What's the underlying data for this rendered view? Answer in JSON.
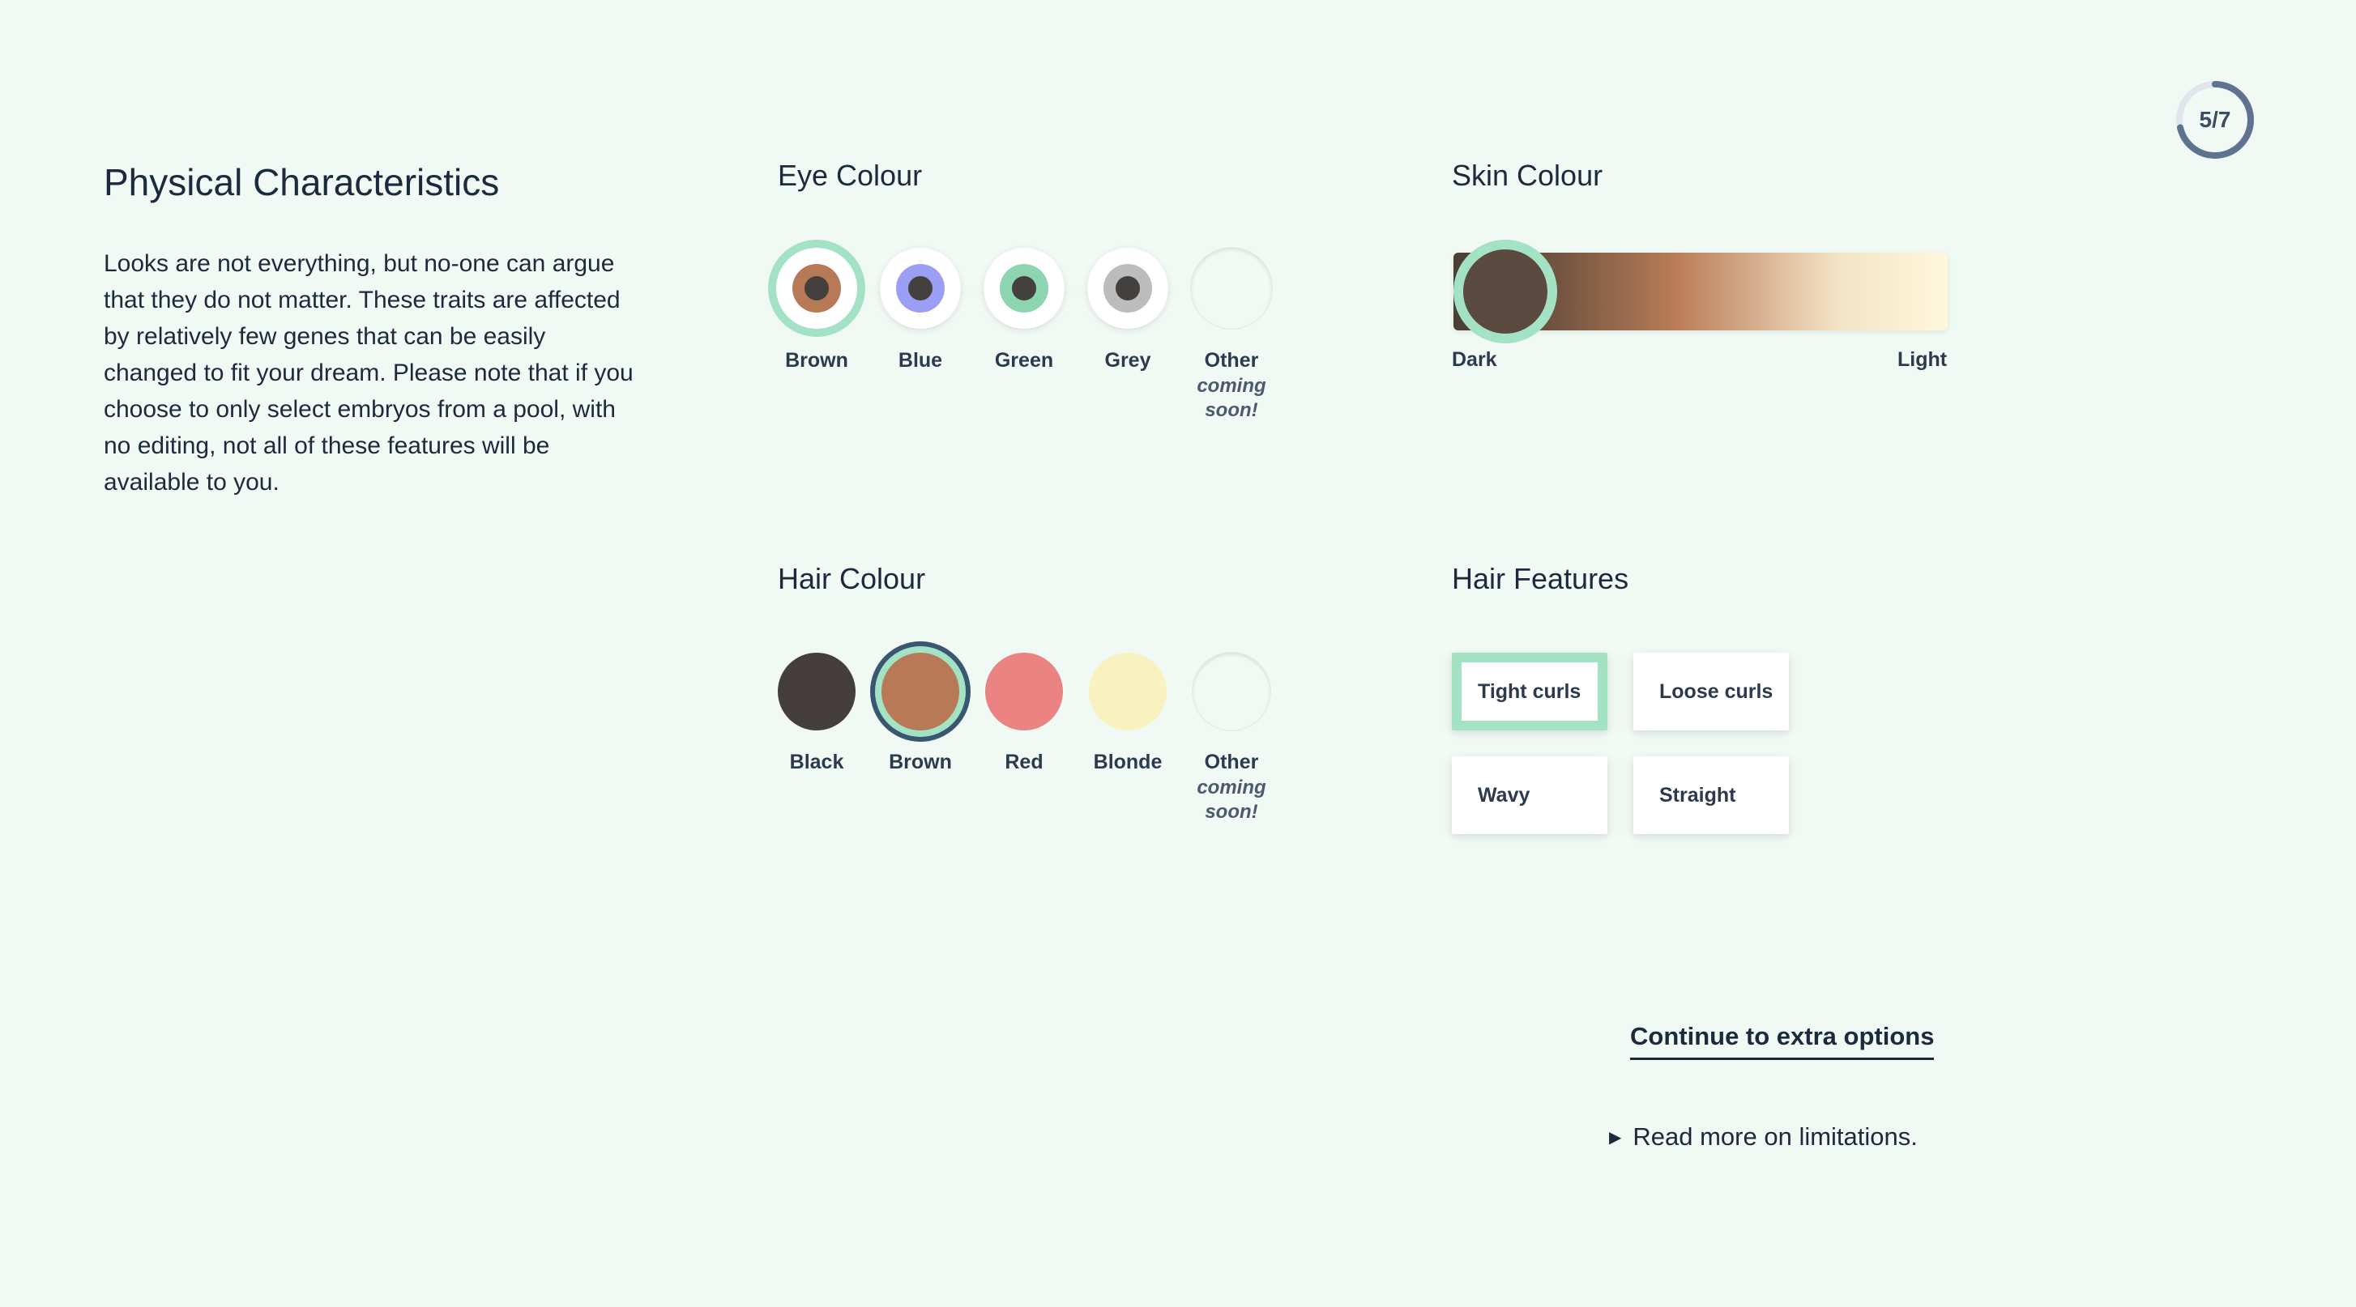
{
  "progress": {
    "label": "5/7",
    "value": 0.714,
    "ring_color": "#5f7391"
  },
  "intro": {
    "title": "Physical Characteristics",
    "text": "Looks are not everything, but no-one can argue that they do not matter. These traits are affected by relatively few genes that can be easily changed to fit your dream. Please note that if you choose to only select embryos from a pool, with no editing, not all of these features will be available to you."
  },
  "eye_colour": {
    "title": "Eye Colour",
    "selected": "Brown",
    "options": [
      {
        "label": "Brown",
        "iris": "#b87a56"
      },
      {
        "label": "Blue",
        "iris": "#9a9ef5"
      },
      {
        "label": "Green",
        "iris": "#8dd4b0"
      },
      {
        "label": "Grey",
        "iris": "#bcbcbc"
      },
      {
        "label": "Other",
        "note": "coming soon!"
      }
    ]
  },
  "skin_colour": {
    "title": "Skin Colour",
    "min_label": "Dark",
    "max_label": "Light",
    "value": 0.0,
    "gradient": [
      "#4c3f36",
      "#b97c57",
      "#f3e3c6",
      "#fff8dc"
    ]
  },
  "hair_colour": {
    "title": "Hair Colour",
    "selected": "Brown",
    "options": [
      {
        "label": "Black",
        "color": "#443f3d"
      },
      {
        "label": "Brown",
        "color": "#b87a56"
      },
      {
        "label": "Red",
        "color": "#ea8381"
      },
      {
        "label": "Blonde",
        "color": "#f8f1c0"
      },
      {
        "label": "Other",
        "note": "coming soon!"
      }
    ]
  },
  "hair_features": {
    "title": "Hair Features",
    "selected": "Tight curls",
    "options": [
      "Tight curls",
      "Loose curls",
      "Wavy",
      "Straight"
    ]
  },
  "continue_label": "Continue to extra options",
  "limitations_label": "Read more on limitations.",
  "colors": {
    "accent": "#a3e2c5",
    "background": "#f0f9f3",
    "text": "#1c2a3d"
  }
}
